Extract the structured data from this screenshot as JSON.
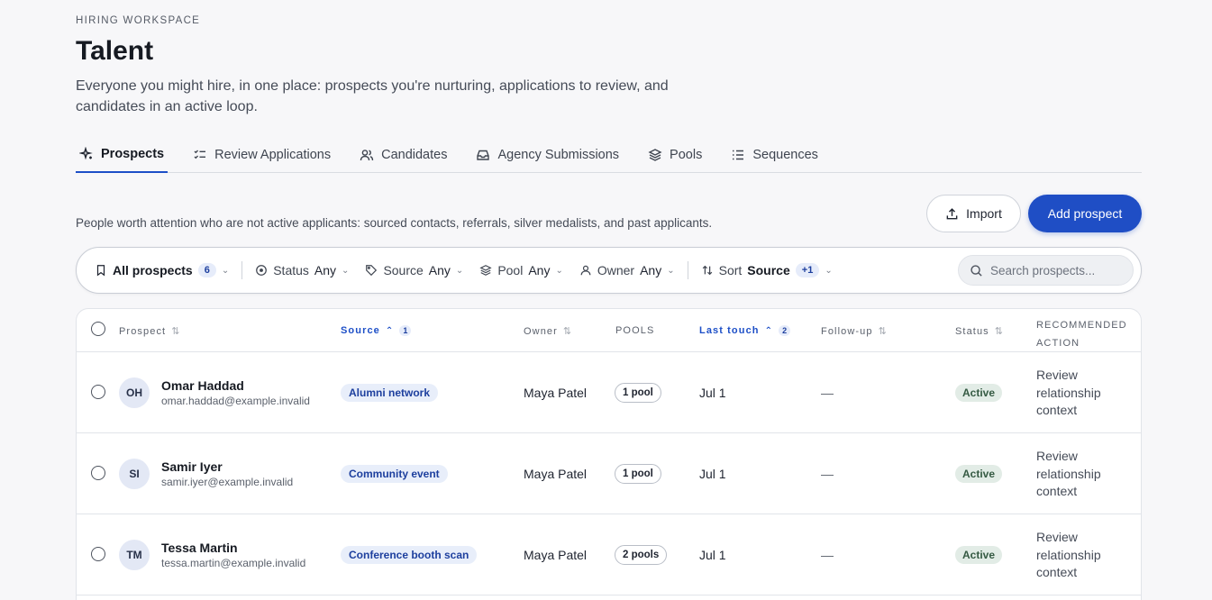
{
  "header": {
    "eyebrow": "HIRING WORKSPACE",
    "title": "Talent",
    "description": "Everyone you might hire, in one place: prospects you're nurturing, applications to review, and candidates in an active loop."
  },
  "tabs": [
    {
      "label": "Prospects",
      "icon": "sparkle-icon",
      "active": true
    },
    {
      "label": "Review Applications",
      "icon": "checklist-icon",
      "active": false
    },
    {
      "label": "Candidates",
      "icon": "users-icon",
      "active": false
    },
    {
      "label": "Agency Submissions",
      "icon": "inbox-icon",
      "active": false
    },
    {
      "label": "Pools",
      "icon": "layers-icon",
      "active": false
    },
    {
      "label": "Sequences",
      "icon": "list-icon",
      "active": false
    }
  ],
  "intro": "People worth attention who are not active applicants: sourced contacts, referrals, silver medalists, and past applicants.",
  "actions": {
    "import_label": "Import",
    "add_label": "Add prospect"
  },
  "filters": {
    "view_label": "All prospects",
    "view_count": "6",
    "status_label": "Status",
    "status_value": "Any",
    "source_label": "Source",
    "source_value": "Any",
    "pool_label": "Pool",
    "pool_value": "Any",
    "owner_label": "Owner",
    "owner_value": "Any",
    "sort_label": "Sort",
    "sort_value": "Source",
    "sort_extra": "+1",
    "search_placeholder": "Search prospects..."
  },
  "table": {
    "columns": {
      "prospect": "Prospect",
      "source": "Source",
      "source_sort_order": "1",
      "owner": "Owner",
      "pools": "POOLS",
      "last_touch": "Last touch",
      "last_touch_sort_order": "2",
      "followup": "Follow-up",
      "status": "Status",
      "recommended_action": "RECOMMENDED ACTION"
    },
    "rows": [
      {
        "initials": "OH",
        "name": "Omar Haddad",
        "email": "omar.haddad@example.invalid",
        "source": "Alumni network",
        "owner": "Maya Patel",
        "pools": "1 pool",
        "last_touch": "Jul 1",
        "followup": "—",
        "status": "Active",
        "action": "Review relationship context"
      },
      {
        "initials": "SI",
        "name": "Samir Iyer",
        "email": "samir.iyer@example.invalid",
        "source": "Community event",
        "owner": "Maya Patel",
        "pools": "1 pool",
        "last_touch": "Jul 1",
        "followup": "—",
        "status": "Active",
        "action": "Review relationship context"
      },
      {
        "initials": "TM",
        "name": "Tessa Martin",
        "email": "tessa.martin@example.invalid",
        "source": "Conference booth scan",
        "owner": "Maya Patel",
        "pools": "2 pools",
        "last_touch": "Jul 1",
        "followup": "—",
        "status": "Active",
        "action": "Review relationship context"
      }
    ]
  },
  "colors": {
    "accent": "#1f4ec5",
    "source_badge_bg": "#e8eefa",
    "status_active_bg": "#e2ece6"
  }
}
